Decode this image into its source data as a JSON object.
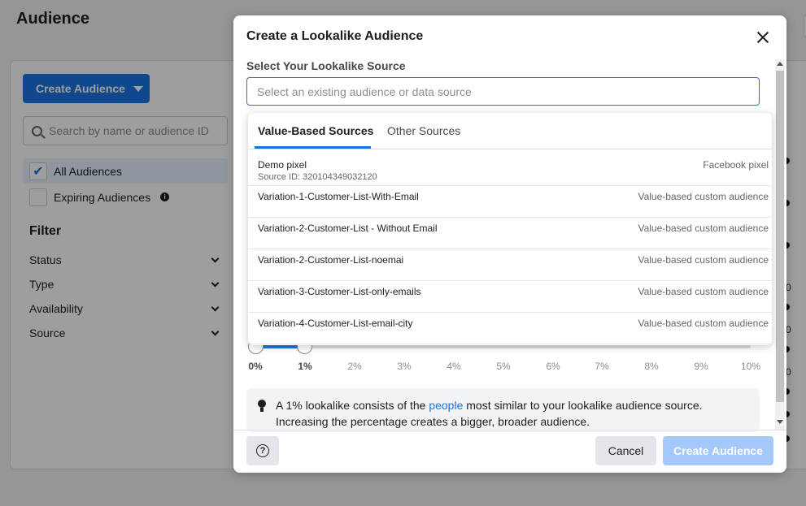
{
  "background": {
    "page_title": "Audience",
    "create_button_label": "Create Audience",
    "search_placeholder": "Search by name or audience ID",
    "checkbox_all": "All Audiences",
    "checkbox_expiring": "Expiring Audiences",
    "filter_title": "Filter",
    "filters": [
      "Status",
      "Type",
      "Availability",
      "Source"
    ],
    "right_numbers": [
      "0",
      "0",
      "0"
    ]
  },
  "modal": {
    "title": "Create a Lookalike Audience",
    "source_label": "Select Your Lookalike Source",
    "source_placeholder": "Select an existing audience or data source",
    "dropdown": {
      "tabs": [
        "Value-Based Sources",
        "Other Sources"
      ],
      "active_tab": "Value-Based Sources",
      "items": [
        {
          "name": "Demo pixel",
          "sub": "Source ID: 320104349032120",
          "type": "Facebook pixel"
        },
        {
          "name": "Variation-1-Customer-List-With-Email",
          "sub": "",
          "type": "Value-based custom audience"
        },
        {
          "name": "Variation-2-Customer-List - Without Email",
          "sub": "",
          "type": "Value-based custom audience"
        },
        {
          "name": "Variation-2-Customer-List-noemai",
          "sub": "",
          "type": "Value-based custom audience"
        },
        {
          "name": "Variation-3-Customer-List-only-emails",
          "sub": "",
          "type": "Value-based custom audience"
        },
        {
          "name": "Variation-4-Customer-List-email-city",
          "sub": "",
          "type": "Value-based custom audience"
        }
      ]
    },
    "slider": {
      "ticks": [
        "0%",
        "1%",
        "2%",
        "3%",
        "4%",
        "5%",
        "6%",
        "7%",
        "8%",
        "9%",
        "10%"
      ],
      "range_start_percent": 0,
      "range_end_percent": 1
    },
    "info": {
      "text_before": "A 1% lookalike consists of the ",
      "link": "people",
      "text_after": " most similar to your lookalike audience source. Increasing the percentage creates a bigger, broader audience."
    },
    "footer": {
      "help_glyph": "?",
      "cancel_label": "Cancel",
      "create_label": "Create Audience"
    }
  },
  "colors": {
    "accent": "#1b74e4",
    "accent_disabled": "#a4c8f9",
    "active_row": "#e7f3ff"
  }
}
